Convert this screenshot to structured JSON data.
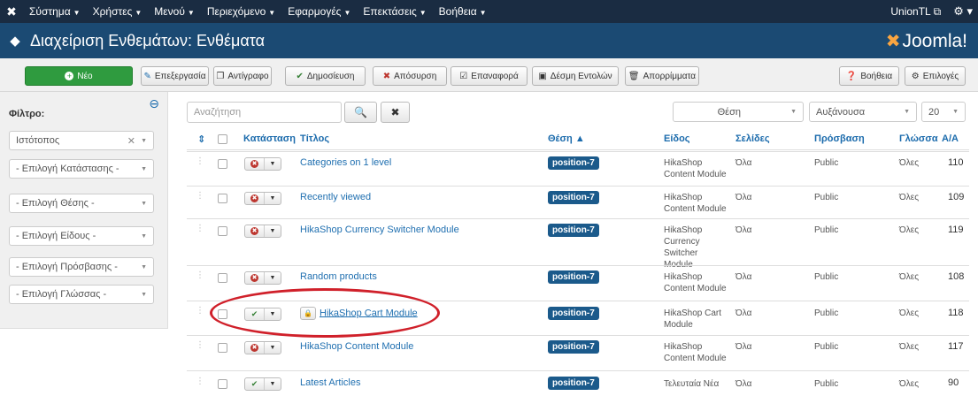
{
  "topnav": {
    "menu": [
      "Σύστημα",
      "Χρήστες",
      "Μενού",
      "Περιεχόμενο",
      "Εφαρμογές",
      "Επεκτάσεις",
      "Βοήθεια"
    ],
    "user": "UnionTL"
  },
  "header": {
    "title": "Διαχείριση Ενθεμάτων: Ενθέματα",
    "brand": "Joomla!"
  },
  "toolbar": {
    "new": "Νέο",
    "edit": "Επεξεργασία",
    "copy": "Αντίγραφο",
    "publish": "Δημοσίευση",
    "unpublish": "Απόσυρση",
    "checkin": "Επαναφορά",
    "batch": "Δέσμη Εντολών",
    "trash": "Απορρίμματα",
    "help": "Βοήθεια",
    "options": "Επιλογές"
  },
  "sidebar": {
    "filter_label": "Φίλτρο:",
    "filters": [
      "Ιστότοπος",
      "- Επιλογή Κατάστασης -",
      "- Επιλογή Θέσης -",
      "- Επιλογή Είδους -",
      "- Επιλογή Πρόσβασης -",
      "- Επιλογή Γλώσσας -"
    ]
  },
  "controls": {
    "search_placeholder": "Αναζήτηση",
    "position": "Θέση",
    "order": "Αυξάνουσα",
    "limit": "20"
  },
  "table": {
    "headers": {
      "status": "Κατάσταση",
      "title": "Τίτλος",
      "position": "Θέση ▲",
      "type": "Είδος",
      "pages": "Σελίδες",
      "access": "Πρόσβαση",
      "language": "Γλώσσα",
      "id": "Α/Α"
    },
    "rows": [
      {
        "title": "Categories on 1 level",
        "position": "position-7",
        "type": "HikaShop Content Module",
        "pages": "Όλα",
        "access": "Public",
        "language": "Όλες",
        "id": "110",
        "published": false
      },
      {
        "title": "Recently viewed",
        "position": "position-7",
        "type": "HikaShop Content Module",
        "pages": "Όλα",
        "access": "Public",
        "language": "Όλες",
        "id": "109",
        "published": false
      },
      {
        "title": "HikaShop Currency Switcher Module",
        "position": "position-7",
        "type": "HikaShop Currency Switcher Module",
        "pages": "Όλα",
        "access": "Public",
        "language": "Όλες",
        "id": "119",
        "published": false
      },
      {
        "title": "Random products",
        "position": "position-7",
        "type": "HikaShop Content Module",
        "pages": "Όλα",
        "access": "Public",
        "language": "Όλες",
        "id": "108",
        "published": false
      },
      {
        "title": "HikaShop Cart Module",
        "position": "position-7",
        "type": "HikaShop Cart Module",
        "pages": "Όλα",
        "access": "Public",
        "language": "Όλες",
        "id": "118",
        "published": true
      },
      {
        "title": "HikaShop Content Module",
        "position": "position-7",
        "type": "HikaShop Content Module",
        "pages": "Όλα",
        "access": "Public",
        "language": "Όλες",
        "id": "117",
        "published": false
      },
      {
        "title": "Latest Articles",
        "position": "position-7",
        "type": "Τελευταία Νέα",
        "pages": "Όλα",
        "access": "Public",
        "language": "Όλες",
        "id": "90",
        "published": true
      }
    ]
  }
}
